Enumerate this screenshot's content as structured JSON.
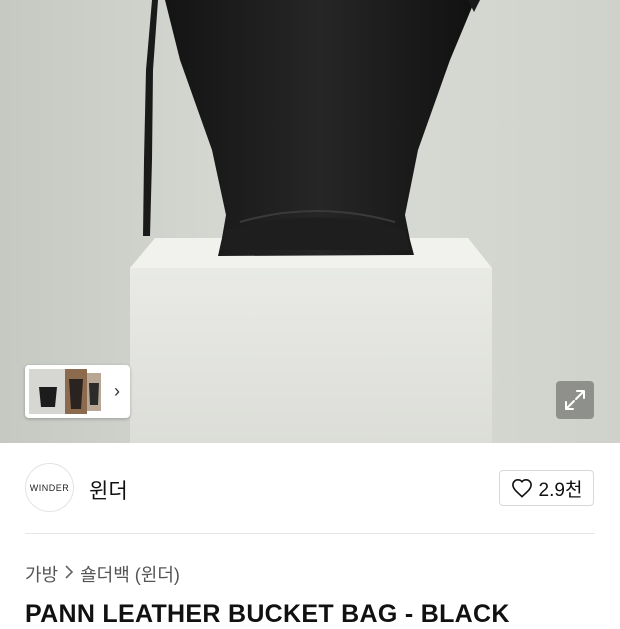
{
  "brand": {
    "logo_text": "WINDER",
    "name": "윈더"
  },
  "like": {
    "icon": "heart-icon",
    "count": "2.9천"
  },
  "breadcrumb": {
    "items": [
      "가방",
      "숄더백 (윈더)"
    ],
    "separator_icon": "chevron-right-icon"
  },
  "product": {
    "title": "PANN LEATHER BUCKET BAG - BLACK"
  },
  "gallery": {
    "thumbnail_more_icon": "chevron-right-icon",
    "expand_icon": "expand-icon"
  }
}
